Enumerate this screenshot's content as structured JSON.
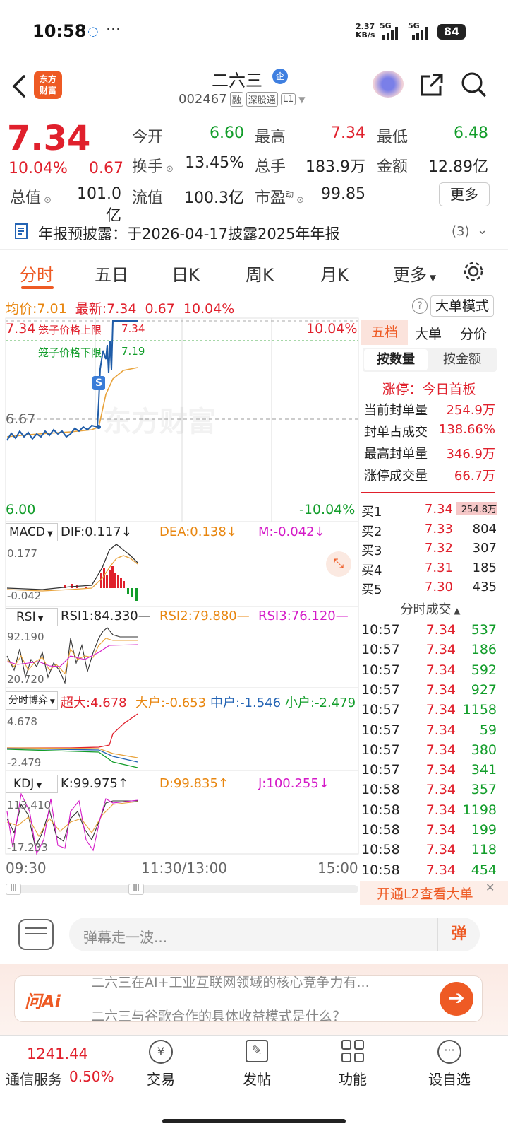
{
  "status": {
    "time": "10:58",
    "speed_top": "2.37",
    "speed_unit": "KB/s",
    "net1": "5G",
    "net2": "5G",
    "battery": "84"
  },
  "header": {
    "logo_text1": "东方",
    "logo_text2": "财富",
    "stock_name": "二六三",
    "badge": "企",
    "code": "002467",
    "tag1": "融",
    "tag2": "深股通",
    "tag3": "L1"
  },
  "quote": {
    "price": "7.34",
    "change_pct": "10.04%",
    "change": "0.67",
    "open_label": "今开",
    "open": "6.60",
    "high_label": "最高",
    "high": "7.34",
    "low_label": "最低",
    "low": "6.48",
    "turnover_label": "换手",
    "turnover": "13.45%",
    "volume_label": "总手",
    "volume": "183.9万",
    "amount_label": "金额",
    "amount": "12.89亿",
    "mktcap_label": "总值",
    "mktcap": "101.0亿",
    "float_label": "流值",
    "float": "100.3亿",
    "pe_label": "市盈",
    "pe_sup": "动",
    "pe": "99.85",
    "more": "更多"
  },
  "notice": {
    "text": "年报预披露：于2026-04-17披露2025年年报",
    "count": "(3)"
  },
  "tabs": [
    "分时",
    "五日",
    "日K",
    "周K",
    "月K",
    "更多"
  ],
  "summary": {
    "avg_label": "均价:",
    "avg": "7.01",
    "latest_label": "最新:",
    "latest": "7.34",
    "chg": "0.67",
    "pct": "10.04%",
    "mode": "大单模式"
  },
  "chart": {
    "top_left": "7.34",
    "upper_limit_label": "笼子价格上限",
    "upper_limit": "7.34",
    "lower_limit_label": "笼子价格下限",
    "lower_limit": "7.19",
    "mid_price": "6.67",
    "bottom_left": "6.00",
    "top_right": "10.04%",
    "bottom_right": "-10.04%",
    "watermark": "东方财富",
    "s_marker": "S",
    "time_start": "09:30",
    "time_mid": "11:30/13:00",
    "time_end": "15:00"
  },
  "macd": {
    "name": "MACD",
    "dif": "DIF:0.117↓",
    "dea": "DEA:0.138↓",
    "m": "M:-0.042↓",
    "top": "0.177",
    "bottom": "-0.042"
  },
  "rsi": {
    "name": "RSI",
    "rsi1": "RSI1:84.330—",
    "rsi2": "RSI2:79.880—",
    "rsi3": "RSI3:76.120—",
    "top": "92.190",
    "bottom": "20.720"
  },
  "fund": {
    "name": "分时博弈",
    "chaoda": "超大:4.678",
    "dahu": "大户:-0.653",
    "zhonghu": "中户:-1.546",
    "xiaohu": "小户:-2.479",
    "top": "4.678",
    "bottom": "-2.479"
  },
  "kdj": {
    "name": "KDJ",
    "k": "K:99.975↑",
    "d": "D:99.835↑",
    "j": "J:100.255↓",
    "top": "113.410",
    "bottom": "-17.233"
  },
  "panel": {
    "tabs": [
      "五档",
      "大单",
      "分价"
    ],
    "subtabs": [
      "按数量",
      "按金额"
    ],
    "limit_title": "涨停：今日首板",
    "rows": [
      {
        "label": "当前封单量",
        "value": "254.9万"
      },
      {
        "label": "封单占成交",
        "value": "138.66%"
      },
      {
        "label": "最高封单量",
        "value": "346.9万"
      },
      {
        "label": "涨停成交量",
        "value": "66.7万"
      }
    ],
    "bids": [
      {
        "label": "买1",
        "price": "7.34",
        "vol": "254.8万"
      },
      {
        "label": "买2",
        "price": "7.33",
        "vol": "804"
      },
      {
        "label": "买3",
        "price": "7.32",
        "vol": "307"
      },
      {
        "label": "买4",
        "price": "7.31",
        "vol": "185"
      },
      {
        "label": "买5",
        "price": "7.30",
        "vol": "435"
      }
    ],
    "ticks_title": "分时成交",
    "ticks": [
      {
        "t": "10:57",
        "p": "7.34",
        "v": "537"
      },
      {
        "t": "10:57",
        "p": "7.34",
        "v": "186"
      },
      {
        "t": "10:57",
        "p": "7.34",
        "v": "592"
      },
      {
        "t": "10:57",
        "p": "7.34",
        "v": "927"
      },
      {
        "t": "10:57",
        "p": "7.34",
        "v": "1158"
      },
      {
        "t": "10:57",
        "p": "7.34",
        "v": "59"
      },
      {
        "t": "10:57",
        "p": "7.34",
        "v": "380"
      },
      {
        "t": "10:57",
        "p": "7.34",
        "v": "341"
      },
      {
        "t": "10:58",
        "p": "7.34",
        "v": "357"
      },
      {
        "t": "10:58",
        "p": "7.34",
        "v": "1198"
      },
      {
        "t": "10:58",
        "p": "7.34",
        "v": "199"
      },
      {
        "t": "10:58",
        "p": "7.34",
        "v": "118"
      },
      {
        "t": "10:58",
        "p": "7.34",
        "v": "454"
      }
    ],
    "l2_text": "开通L2查看大单"
  },
  "comment": {
    "placeholder": "弹幕走一波...",
    "danmu": "弹"
  },
  "ai": {
    "logo": "问Ai",
    "line1": "二六三在AI+工业互联网领域的核心竞争力有...",
    "line2": "二六三与谷歌合作的具体收益模式是什么？"
  },
  "bottom_nav": {
    "index_value": "1241.44",
    "index_name": "通信服务",
    "index_pct": "0.50%",
    "items": [
      "交易",
      "发帖",
      "功能",
      "设自选"
    ]
  },
  "colors": {
    "up": "#e0202c",
    "down": "#129d2a",
    "accent": "#ee5a24"
  }
}
